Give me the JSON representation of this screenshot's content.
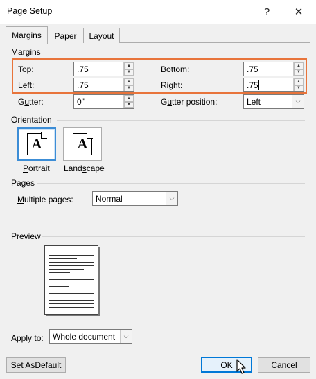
{
  "window": {
    "title": "Page Setup",
    "help_glyph": "?",
    "close_glyph": "✕"
  },
  "tabs": [
    {
      "label": "Margins"
    },
    {
      "label": "Paper"
    },
    {
      "label": "Layout"
    }
  ],
  "margins": {
    "section_label": "Margins",
    "top": {
      "label_ul": "T",
      "label_rest": "op:",
      "value": ".75"
    },
    "bottom": {
      "label_pre": "",
      "label_ul": "B",
      "label_rest": "ottom:",
      "value": ".75"
    },
    "left": {
      "label_ul": "L",
      "label_rest": "eft:",
      "value": ".75"
    },
    "right": {
      "label_ul": "R",
      "label_rest": "ight:",
      "value": ".75"
    },
    "gutter": {
      "label_pre": "G",
      "label_ul": "u",
      "label_rest": "tter:",
      "value": "0\""
    },
    "gutter_position": {
      "label_pre": "G",
      "label_ul": "u",
      "label_rest": "tter position:",
      "value": "Left"
    }
  },
  "orientation": {
    "section_label": "Orientation",
    "portrait": {
      "label_ul": "P",
      "label_rest": "ortrait",
      "glyph": "A"
    },
    "landscape": {
      "label_pre": "Land",
      "label_ul": "s",
      "label_rest": "cape",
      "glyph": "A"
    }
  },
  "pages": {
    "section_label": "Pages",
    "multiple_pages": {
      "label_ul": "M",
      "label_rest": "ultiple pages:",
      "value": "Normal"
    }
  },
  "preview": {
    "section_label": "Preview"
  },
  "apply": {
    "label_pre": "Appl",
    "label_ul": "y",
    "label_rest": " to:",
    "value": "Whole document"
  },
  "buttons": {
    "set_default": {
      "label_pre": "Set As ",
      "label_ul": "D",
      "label_rest": "efault"
    },
    "ok": "OK",
    "cancel": "Cancel"
  },
  "colors": {
    "highlight": "#e8743b",
    "accent": "#0078d7",
    "selected_border": "#3c8dd6"
  }
}
